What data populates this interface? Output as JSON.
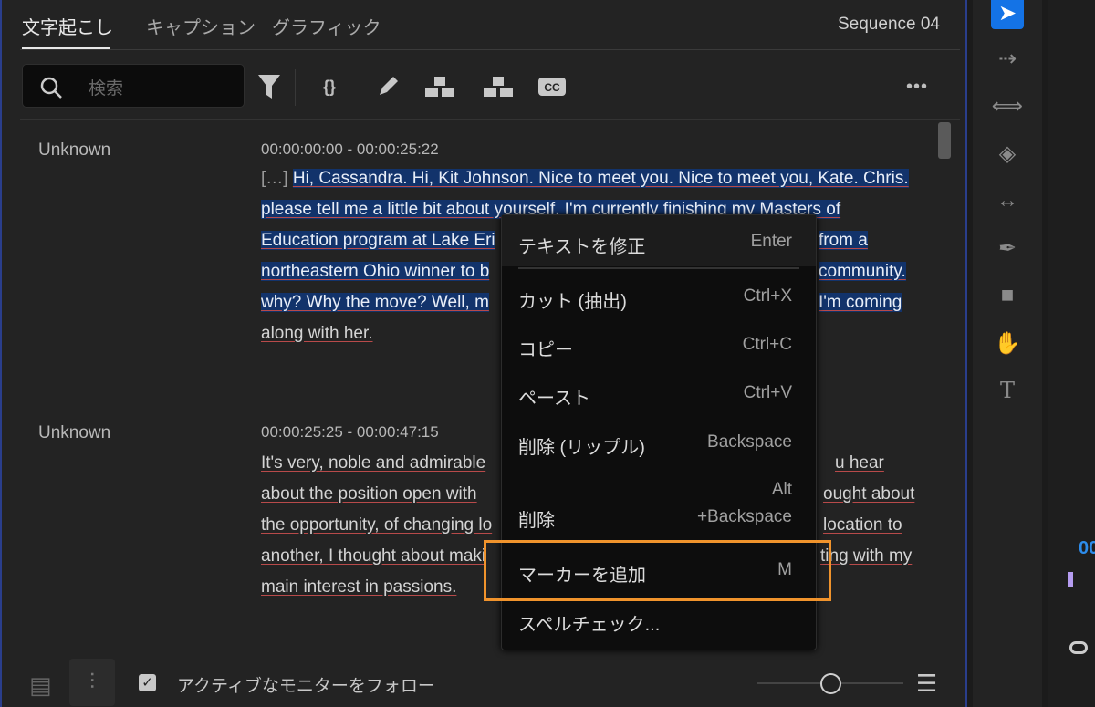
{
  "tabs": [
    {
      "label": "文字起こし",
      "active": true
    },
    {
      "label": "キャプション"
    },
    {
      "label": "グラフィック"
    }
  ],
  "sequence": "Sequence 04",
  "search": {
    "placeholder": "検索"
  },
  "toolbar": [
    "filter-icon",
    "merge-icon",
    "pencil-icon",
    "hierarchy-icon",
    "hierarchy-split-icon",
    "cc-icon",
    "more-icon"
  ],
  "transcript": [
    {
      "speaker": "Unknown",
      "timecode": "00:00:00:00 - 00:00:25:22",
      "lines": [
        {
          "left": "Hi, Cassandra. Hi, Kit Johnson. Nice to meet you. Nice to meet you, Kate. Chris.",
          "prefix": "[…]"
        },
        {
          "left": "please tell me a little bit about yourself. I'm currently finishing my Masters of"
        },
        {
          "left": "Education program at Lake Eri",
          "right": "from a"
        },
        {
          "left": "northeastern Ohio winner to b",
          "right": "community."
        },
        {
          "left": "why? Why the move? Well, m",
          "right": "I'm coming"
        },
        {
          "left": "along with her."
        }
      ]
    },
    {
      "speaker": "Unknown",
      "timecode": "00:00:25:25 - 00:00:47:15",
      "lines": [
        {
          "left": "It's very, noble and admirable",
          "right": "u hear"
        },
        {
          "left": "about the position open with",
          "right": "ought about"
        },
        {
          "left": "the opportunity, of changing lo",
          "right": "location to"
        },
        {
          "left": "another, I thought about maki",
          "right": "ting with my"
        },
        {
          "left": "main interest in passions."
        }
      ]
    }
  ],
  "context_menu": [
    {
      "label": "テキストを修正",
      "shortcut": "Enter"
    },
    {
      "label": "カット (抽出)",
      "shortcut": "Ctrl+X"
    },
    {
      "label": "コピー",
      "shortcut": "Ctrl+C"
    },
    {
      "label": "ペースト",
      "shortcut": "Ctrl+V"
    },
    {
      "label": "削除 (リップル)",
      "shortcut": "Backspace"
    },
    {
      "label": "削除",
      "shortcut": "Alt",
      "shortcut2": "+Backspace"
    },
    {
      "label": "マーカーを追加",
      "shortcut": "M",
      "highlighted": true
    },
    {
      "label": "スペルチェック..."
    }
  ],
  "footer": {
    "follow_label": "アクティブなモニターをフォロー",
    "follow_checked": true
  },
  "tools": [
    "selection-tool",
    "track-select-tool",
    "ripple-edit-tool",
    "razor-tool",
    "slip-tool",
    "pen-tool",
    "rectangle-tool",
    "hand-tool",
    "type-tool"
  ],
  "timeline": {
    "timecode_fragment": "00"
  },
  "colors": {
    "accent": "#1473e6",
    "highlight_box": "#f0932c",
    "selection": "#12336b"
  }
}
